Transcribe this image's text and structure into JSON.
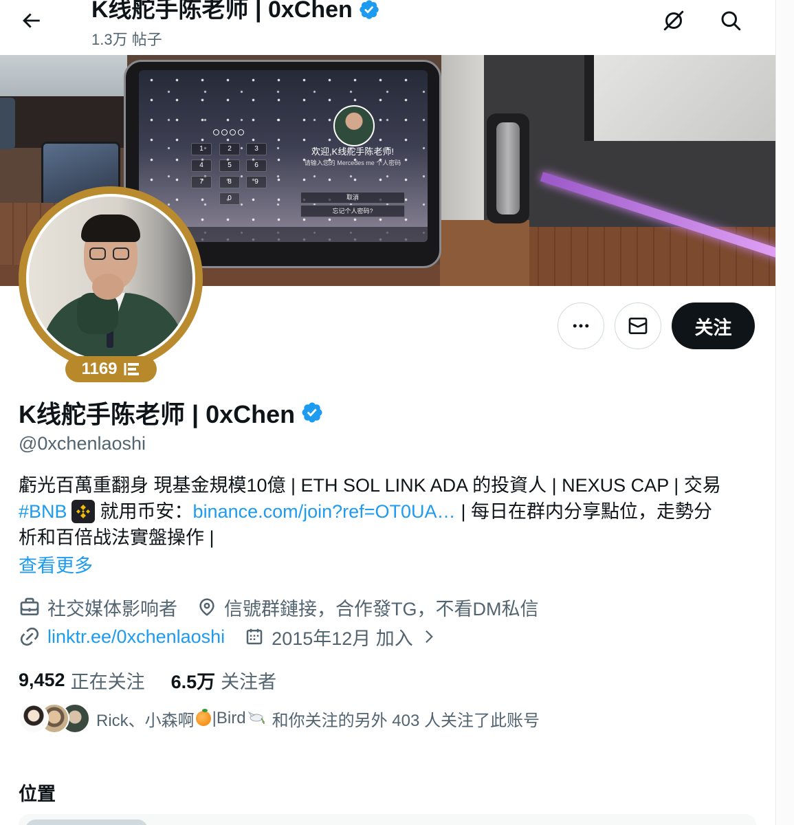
{
  "colors": {
    "accent": "#1d9bf0",
    "text": "#0f1419",
    "secondary": "#536471",
    "gold": "#b8892a",
    "follow_bg": "#0f1419"
  },
  "header": {
    "title": "K线舵手陈老师 | 0xChen",
    "posts_count": "1.3万 帖子",
    "icons": {
      "back": "back-arrow-icon",
      "grok": "grok-icon",
      "search": "search-icon",
      "verified": "verified-badge-icon"
    }
  },
  "banner": {
    "screen": {
      "greeting": "欢迎,K线舵手陈老师!",
      "prompt": "请输入您的 Mercedes me 个人密码",
      "keys": [
        "1",
        "2",
        "3",
        "4",
        "5",
        "6",
        "7",
        "8",
        "9",
        "0"
      ],
      "cancel": "取消",
      "forgot": "忘记个人密码?"
    }
  },
  "profile": {
    "badge_count": "1169",
    "display_name": "K线舵手陈老师 | 0xChen",
    "handle": "@0xchenlaoshi"
  },
  "actions": {
    "more_icon": "more-icon",
    "message_icon": "mail-icon",
    "follow_label": "关注"
  },
  "bio": {
    "line1": "虧光百萬重翻身 現基金規模10億 | ETH SOL LINK ADA 的投資人 |  NEXUS CAP | 交易",
    "hashtag": "#BNB",
    "hashtag_icon": "bnb-logo-icon",
    "text_before_link": "就用币安：",
    "link": "binance.com/join?ref=OT0UA…",
    "text_after_link": "| 每日在群内分享點位，走勢分",
    "line3": "析和百倍战法實盤操作 |",
    "show_more": "查看更多"
  },
  "meta": {
    "category": "社交媒体影响者",
    "location": "信號群鏈接，合作發TG，不看DM私信",
    "website": "linktr.ee/0xchenlaoshi",
    "joined": "2015年12月 加入",
    "icons": {
      "category": "briefcase-icon",
      "location": "location-pin-icon",
      "website": "link-icon",
      "joined": "calendar-icon",
      "more": "chevron-right-icon"
    }
  },
  "stats": {
    "following_count": "9,452",
    "following_label": "正在关注",
    "followers_count": "6.5万",
    "followers_label": "关注者"
  },
  "followed_by": {
    "names_part1": "Rick、小森啊",
    "emoji1": "orange-emoji-icon",
    "names_part2": "|Bird",
    "emoji2": "dove-emoji-icon",
    "suffix": "和你关注的另外 403 人关注了此账号"
  },
  "section": {
    "title": "位置"
  }
}
